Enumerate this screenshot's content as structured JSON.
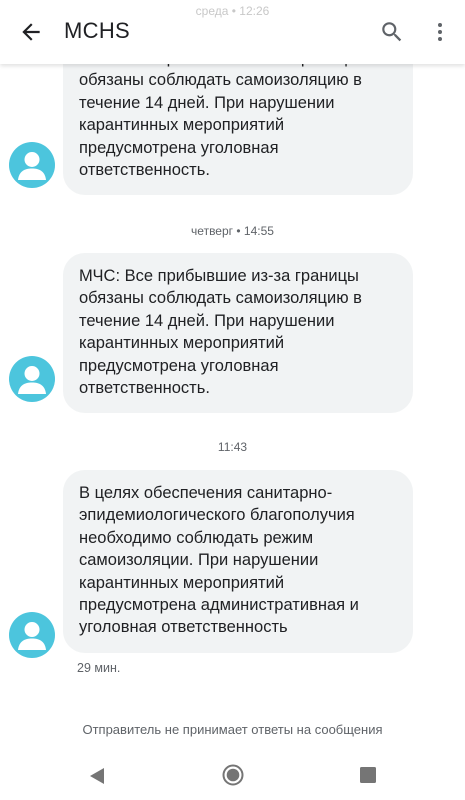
{
  "header": {
    "title": "MCHS",
    "peek_timestamp": "среда • 12:26",
    "icons": {
      "back": "arrow-back-icon",
      "search": "search-icon",
      "more": "more-vert-icon"
    }
  },
  "messages": [
    {
      "text": "МЧС: Все прибывшие из-за границы обязаны соблюдать самоизоляцию в течение 14 дней. При нарушении карантинных мероприятий предусмотрена уголовная ответственность.",
      "avatar_icon": "person-icon"
    },
    {
      "timestamp_before": "четверг • 14:55",
      "text": "МЧС: Все прибывшие из-за границы обязаны соблюдать самоизоляцию в течение 14 дней. При нарушении карантинных мероприятий предусмотрена уголовная ответственность.",
      "avatar_icon": "person-icon"
    },
    {
      "timestamp_before": "11:43",
      "text": "В целях обеспечения санитарно-эпидемиологического благополучия необходимо соблюдать режим самоизоляции. При нарушении карантинных мероприятий предусмотрена административная и уголовная ответственность",
      "avatar_icon": "person-icon",
      "relative_time": "29 мин."
    }
  ],
  "footer_notice": "Отправитель не принимает ответы на сообщения",
  "navbar": {
    "icons": [
      "nav-back-icon",
      "nav-home-icon",
      "nav-recents-icon"
    ]
  },
  "colors": {
    "avatar": "#4cc5dd",
    "bubble": "#f1f3f4",
    "text": "#202124",
    "secondary_text": "#5f6368"
  }
}
